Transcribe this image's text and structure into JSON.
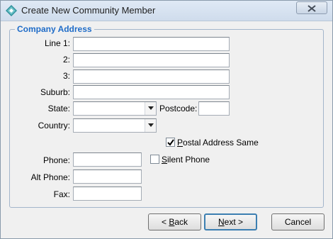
{
  "window": {
    "title": "Create New Community Member",
    "app_icon": "diamond-app-icon",
    "close_icon": "close-icon"
  },
  "group": {
    "title": "Company Address"
  },
  "address": {
    "line1_label": "Line 1:",
    "line2_label": "2:",
    "line3_label": "3:",
    "suburb_label": "Suburb:",
    "state_label": "State:",
    "postcode_label": "Postcode:",
    "country_label": "Country:",
    "line1": "",
    "line2": "",
    "line3": "",
    "suburb": "",
    "state": "",
    "postcode": "",
    "country": ""
  },
  "postal_same": {
    "label_pre": "",
    "label_u": "P",
    "label_post": "ostal Address Same",
    "checked": true
  },
  "contact": {
    "phone_label": "Phone:",
    "alt_phone_label": "Alt Phone:",
    "fax_label": "Fax:",
    "phone": "",
    "alt_phone": "",
    "fax": ""
  },
  "silent_phone": {
    "label_u": "S",
    "label_post": "ilent Phone",
    "checked": false
  },
  "buttons": {
    "back_pre": "< ",
    "back_u": "B",
    "back_post": "ack",
    "next_u": "N",
    "next_post": "ext >",
    "cancel": "Cancel"
  },
  "colors": {
    "accent": "#1f6cc8",
    "group_border": "#a3b5cb",
    "title_bg": "#dfe9f5"
  }
}
